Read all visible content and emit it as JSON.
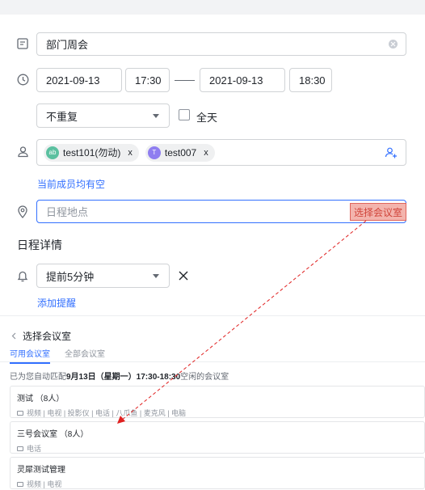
{
  "form": {
    "title_value": "部门周会",
    "start_date": "2021-09-13",
    "start_time": "17:30",
    "end_date": "2021-09-13",
    "end_time": "18:30",
    "repeat": "不重复",
    "all_day_label": "全天",
    "attendees": [
      {
        "avatar": "ab",
        "name": "test101(勿动)",
        "color": "#5bc0a0"
      },
      {
        "avatar": "T",
        "name": "test007",
        "color": "#8f7ef0"
      }
    ],
    "attendee_remove": "x",
    "availability_link": "当前成员均有空",
    "location_placeholder": "日程地点",
    "select_room_label": "选择会议室",
    "details_title": "日程详情",
    "reminder": "提前5分钟",
    "add_reminder": "添加提醒"
  },
  "room_panel": {
    "title": "选择会议室",
    "tabs": [
      "可用会议室",
      "全部会议室"
    ],
    "hint_prefix": "已为您自动匹配",
    "hint_bold": "9月13日（星期一）17:30-18:30",
    "hint_suffix": "空闲的会议室",
    "rooms": [
      {
        "name": "测试 （8人）",
        "features": "视频 | 电视 | 投影仪 | 电话 | 八爪鱼 | 麦克风 | 电脑"
      },
      {
        "name": "三号会议室 （8人）",
        "features": "电话"
      },
      {
        "name": "灵犀测试管理",
        "features": "视频 | 电视"
      }
    ]
  },
  "colors": {
    "accent": "#3370ff",
    "annotation_red": "#e02020"
  }
}
